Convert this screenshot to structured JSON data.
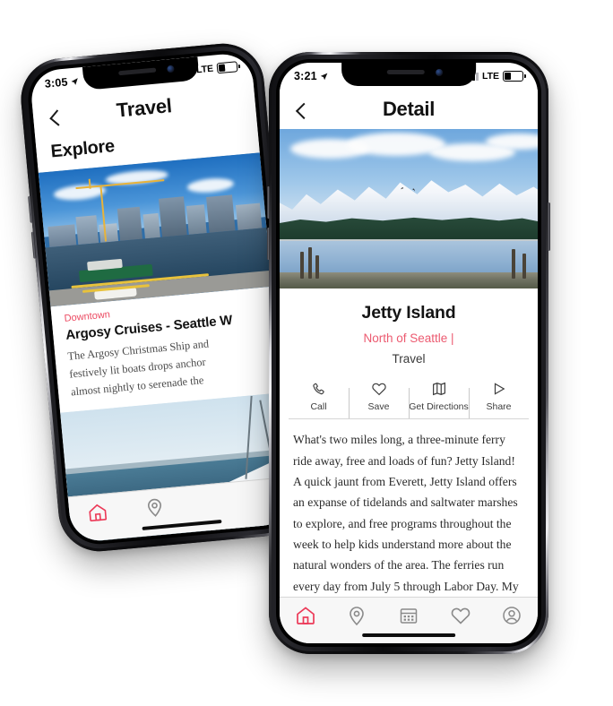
{
  "accent": {
    "red": "#ec3a58",
    "region_red": "#ec5a70",
    "kicker_red": "#ec4a62"
  },
  "back_phone": {
    "status": {
      "time": "3:05",
      "network": "LTE",
      "location_arrow": "location-arrow-icon"
    },
    "nav": {
      "title": "Travel",
      "back": "back-chevron-icon"
    },
    "section_heading": "Explore",
    "card": {
      "kicker": "Downtown",
      "title": "Argosy Cruises - Seattle W",
      "body_lines": [
        "The Argosy Christmas Ship and",
        "festively lit boats drops anchor",
        "almost nightly to serenade the"
      ]
    },
    "tabs": [
      {
        "name": "home",
        "icon": "home-icon",
        "active": true
      },
      {
        "name": "places",
        "icon": "map-pin-icon",
        "active": false
      }
    ]
  },
  "front_phone": {
    "status": {
      "time": "3:21",
      "network": "LTE",
      "location_arrow": "location-arrow-icon"
    },
    "nav": {
      "title": "Detail",
      "back": "back-chevron-icon"
    },
    "place": {
      "name": "Jetty Island",
      "region": "North of Seattle |",
      "category": "Travel"
    },
    "actions": [
      {
        "label": "Call",
        "icon": "phone-icon"
      },
      {
        "label": "Save",
        "icon": "heart-icon"
      },
      {
        "label": "Get Directions",
        "icon": "map-icon"
      },
      {
        "label": "Share",
        "icon": "share-icon"
      }
    ],
    "article": "What's two miles long, a three-minute ferry ride away, free and loads of fun? Jetty Island! A quick jaunt from Everett, Jetty Island offers an expanse of tidelands and saltwater marshes to explore, and free programs throughout the week to help kids understand more about the natural wonders of the area. The ferries run every day from July 5 through Labor Day. My",
    "tabs": [
      {
        "name": "home",
        "icon": "home-icon",
        "active": true
      },
      {
        "name": "places",
        "icon": "map-pin-icon",
        "active": false
      },
      {
        "name": "events",
        "icon": "calendar-icon",
        "active": false
      },
      {
        "name": "favorites",
        "icon": "heart-icon",
        "active": false
      },
      {
        "name": "profile",
        "icon": "person-icon",
        "active": false
      }
    ]
  }
}
